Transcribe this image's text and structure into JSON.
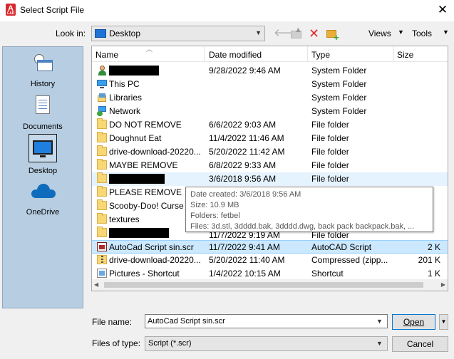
{
  "window": {
    "title": "Select Script File",
    "app_icon_letter": "A",
    "app_icon_sub": "CAD",
    "close_glyph": "✕"
  },
  "toolbar": {
    "lookin_label": "Look in:",
    "lookin_value": "Desktop",
    "views_label": "Views",
    "tools_label": "Tools",
    "back_glyph": "🡐",
    "delete_glyph": "✕"
  },
  "places": [
    {
      "label": "History",
      "icon": "history-icon"
    },
    {
      "label": "Documents",
      "icon": "documents-icon"
    },
    {
      "label": "Desktop",
      "icon": "desktop-icon"
    },
    {
      "label": "OneDrive",
      "icon": "onedrive-icon"
    }
  ],
  "list": {
    "columns": [
      "Name",
      "Date modified",
      "Type",
      "Size"
    ],
    "rows": [
      {
        "name": "",
        "redacted": true,
        "date": "9/28/2022 9:46 AM",
        "type": "System Folder",
        "size": "",
        "icon": "user-icon"
      },
      {
        "name": "This PC",
        "date": "",
        "type": "System Folder",
        "size": "",
        "icon": "pc-icon"
      },
      {
        "name": "Libraries",
        "date": "",
        "type": "System Folder",
        "size": "",
        "icon": "library-icon"
      },
      {
        "name": "Network",
        "date": "",
        "type": "System Folder",
        "size": "",
        "icon": "network-icon"
      },
      {
        "name": "DO NOT REMOVE",
        "date": "6/6/2022 9:03 AM",
        "type": "File folder",
        "size": "",
        "icon": "folder-icon"
      },
      {
        "name": "Doughnut Eat",
        "date": "11/4/2022 11:46 AM",
        "type": "File folder",
        "size": "",
        "icon": "folder-icon"
      },
      {
        "name": "drive-download-20220...",
        "date": "5/20/2022 11:42 AM",
        "type": "File folder",
        "size": "",
        "icon": "folder-icon"
      },
      {
        "name": "MAYBE REMOVE",
        "date": "6/8/2022 9:33 AM",
        "type": "File folder",
        "size": "",
        "icon": "folder-icon"
      },
      {
        "name": "",
        "redacted": true,
        "date": "3/6/2018 9:56 AM",
        "type": "File folder",
        "size": "",
        "icon": "folder-icon",
        "state": "hover"
      },
      {
        "name": "PLEASE REMOVE",
        "date": "",
        "type": "",
        "size": "",
        "icon": "folder-icon"
      },
      {
        "name": "Scooby-Doo! Curse of...",
        "date": "",
        "type": "",
        "size": "",
        "icon": "folder-icon"
      },
      {
        "name": "textures",
        "date": "",
        "type": "",
        "size": "",
        "icon": "folder-icon"
      },
      {
        "name": "",
        "redacted": true,
        "date": "11/7/2022 9:19 AM",
        "type": "File folder",
        "size": "",
        "icon": "folder-icon"
      },
      {
        "name": "AutoCad Script sin.scr",
        "date": "11/7/2022 9:41 AM",
        "type": "AutoCAD Script",
        "size": "2 K",
        "icon": "script-icon",
        "state": "selected"
      },
      {
        "name": "drive-download-20220...",
        "date": "5/20/2022 11:40 AM",
        "type": "Compressed (zipp...",
        "size": "201 K",
        "icon": "zip-icon"
      },
      {
        "name": "Pictures - Shortcut",
        "date": "1/4/2022 10:15 AM",
        "type": "Shortcut",
        "size": "1 K",
        "icon": "shortcut-icon"
      }
    ]
  },
  "tooltip": {
    "line1": "Date created: 3/6/2018 9:56 AM",
    "line2": "Size: 10.9 MB",
    "line3": "Folders: fetbel",
    "line4": "Files: 3d.stl, 3dddd.bak, 3dddd.dwg, back pack backpack.bak, ..."
  },
  "footer": {
    "filename_label": "File name:",
    "filename_value": "AutoCad Script sin.scr",
    "filetype_label": "Files of type:",
    "filetype_value": "Script (*.scr)",
    "open_label": "Open",
    "cancel_label": "Cancel"
  }
}
